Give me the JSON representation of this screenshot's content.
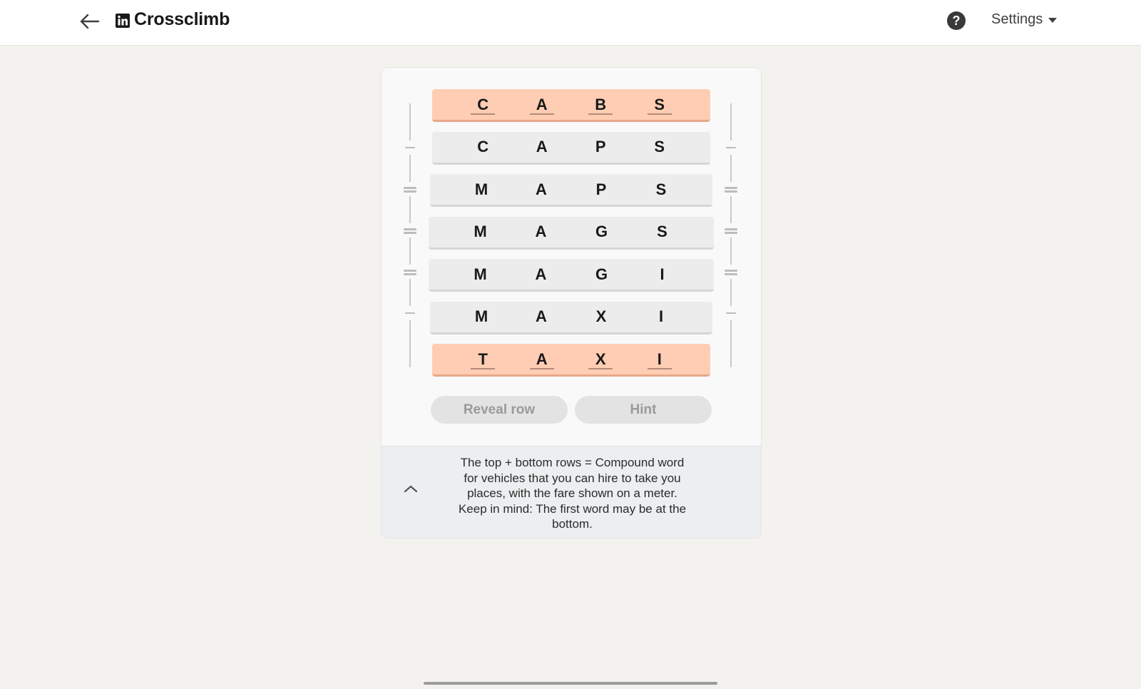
{
  "header": {
    "title": "Crossclimb",
    "settings_label": "Settings",
    "help_symbol": "?",
    "icons": {
      "back": "arrow-left-icon",
      "logo": "linkedin-logo-icon",
      "help": "question-circle-icon",
      "dropdown": "caret-down-icon"
    }
  },
  "puzzle": {
    "rows": [
      {
        "letters": [
          "C",
          "A",
          "B",
          "S"
        ],
        "locked": true
      },
      {
        "letters": [
          "C",
          "A",
          "P",
          "S"
        ],
        "locked": false
      },
      {
        "letters": [
          "M",
          "A",
          "P",
          "S"
        ],
        "locked": false
      },
      {
        "letters": [
          "M",
          "A",
          "G",
          "S"
        ],
        "locked": false
      },
      {
        "letters": [
          "M",
          "A",
          "G",
          "I"
        ],
        "locked": false
      },
      {
        "letters": [
          "M",
          "A",
          "X",
          "I"
        ],
        "locked": false
      },
      {
        "letters": [
          "T",
          "A",
          "X",
          "I"
        ],
        "locked": true
      }
    ]
  },
  "actions": {
    "reveal_label": "Reveal row",
    "hint_label": "Hint"
  },
  "clue": {
    "lines": [
      "The top + bottom rows = Compound word",
      "for vehicles that you can hire to take you",
      "places, with the fare shown on a meter.",
      "Keep in mind: The first word may be at the",
      "bottom."
    ],
    "toggle_icon": "chevron-up-icon"
  },
  "colors": {
    "locked_row": "#ffcdb3",
    "row": "#ececec",
    "background": "#f3f2ef"
  }
}
